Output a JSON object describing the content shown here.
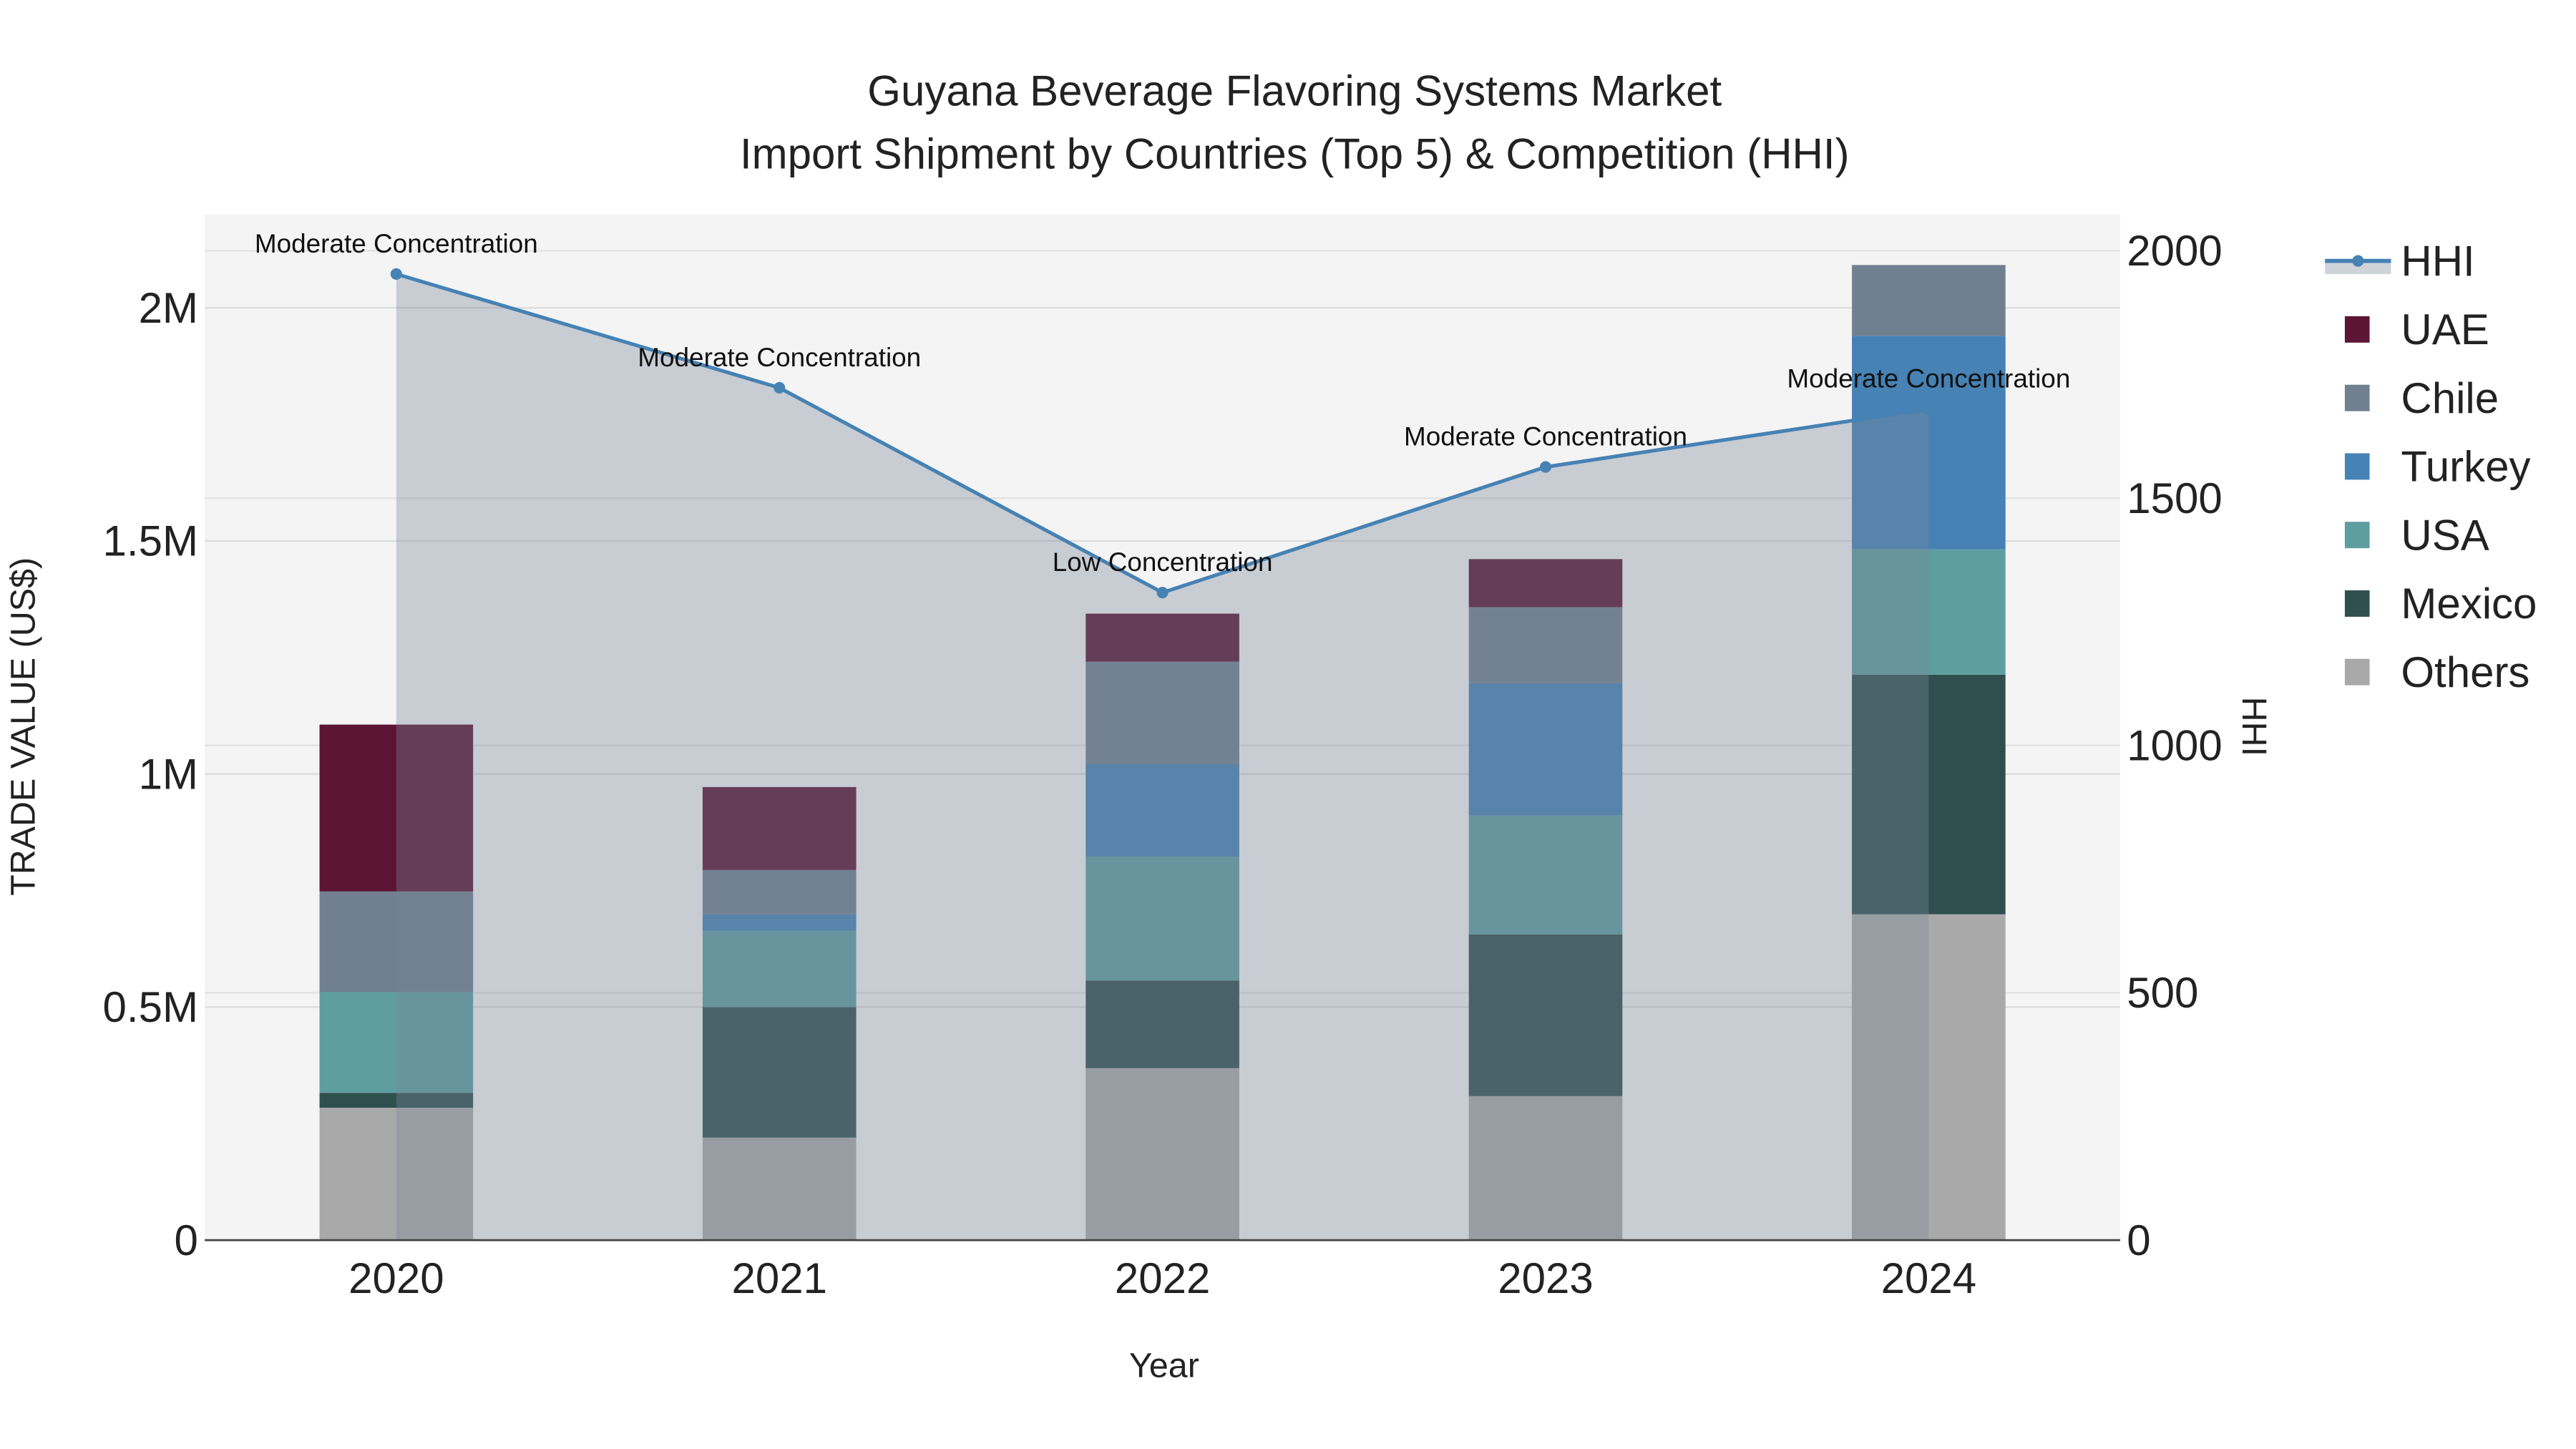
{
  "chart_data": {
    "type": "bar",
    "title": "Guyana Beverage Flavoring Systems Market",
    "subtitle": "Import Shipment by Countries (Top 5) & Competition (HHI)",
    "xlabel": "Year",
    "ylabel": "TRADE VALUE (US$)",
    "y2label": "HHI",
    "categories": [
      "2020",
      "2021",
      "2022",
      "2023",
      "2024"
    ],
    "stacked": true,
    "ylim": [
      0,
      2200000
    ],
    "y2lim": [
      0,
      2073
    ],
    "yticks": [
      {
        "v": 0,
        "label": "0"
      },
      {
        "v": 500000,
        "label": "0.5M"
      },
      {
        "v": 1000000,
        "label": "1M"
      },
      {
        "v": 1500000,
        "label": "1.5M"
      },
      {
        "v": 2000000,
        "label": "2M"
      }
    ],
    "y2ticks": [
      {
        "v": 0,
        "label": "0"
      },
      {
        "v": 500,
        "label": "500"
      },
      {
        "v": 1000,
        "label": "1000"
      },
      {
        "v": 1500,
        "label": "1500"
      },
      {
        "v": 2000,
        "label": "2000"
      }
    ],
    "grid": true,
    "legend_position": "right",
    "series": [
      {
        "name": "Others",
        "color": "#a9a9a9",
        "values": [
          284000,
          220000,
          369000,
          309000,
          699000
        ]
      },
      {
        "name": "Mexico",
        "color": "#2f4f4f",
        "values": [
          32000,
          280000,
          188000,
          347000,
          514000
        ]
      },
      {
        "name": "USA",
        "color": "#5f9ea0",
        "values": [
          216000,
          163000,
          266000,
          255000,
          269000
        ]
      },
      {
        "name": "Turkey",
        "color": "#4682b4",
        "values": [
          0,
          36000,
          198000,
          284000,
          458000
        ]
      },
      {
        "name": "Chile",
        "color": "#708090",
        "values": [
          216000,
          95000,
          220000,
          163000,
          152000
        ]
      },
      {
        "name": "UAE",
        "color": "#5c1535",
        "values": [
          358000,
          178000,
          103000,
          103000,
          0
        ]
      }
    ],
    "line": {
      "name": "HHI",
      "color": "#4682b4",
      "values": [
        1953,
        1723,
        1309,
        1563,
        1680
      ],
      "annotations": [
        "Moderate Concentration",
        "Moderate Concentration",
        "Low Concentration",
        "Moderate Concentration",
        "Moderate Concentration"
      ]
    },
    "legend": [
      "HHI",
      "UAE",
      "Chile",
      "Turkey",
      "USA",
      "Mexico",
      "Others"
    ]
  }
}
